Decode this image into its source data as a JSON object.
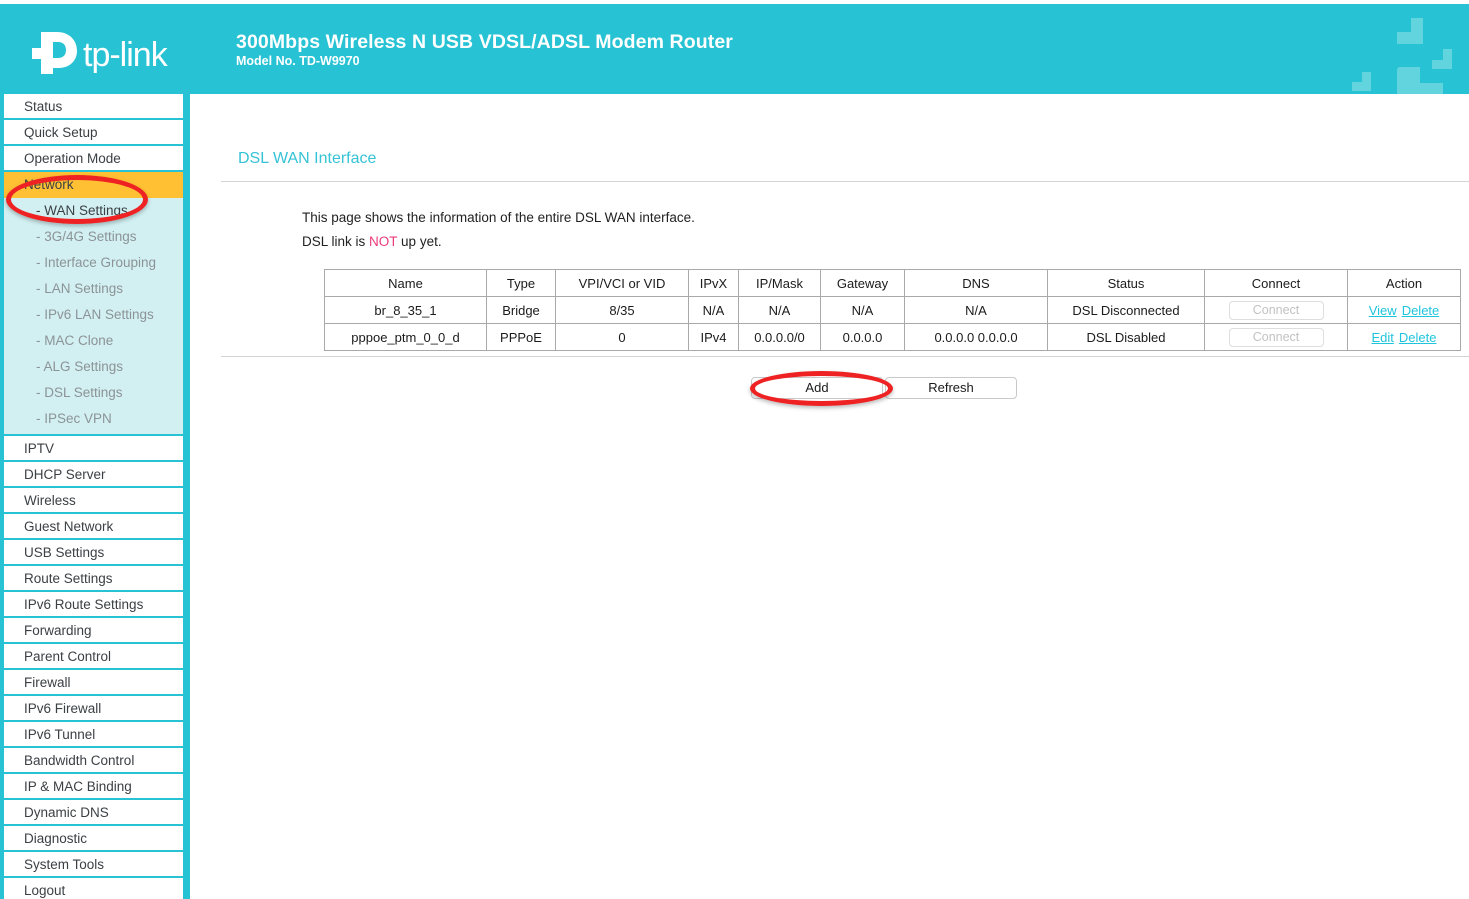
{
  "header": {
    "brand": "tp-link",
    "title": "300Mbps Wireless N USB VDSL/ADSL Modem Router",
    "model": "Model No. TD-W9970",
    "brand_color": "#27c2d3"
  },
  "sidebar": {
    "items": [
      {
        "label": "Status",
        "active": false
      },
      {
        "label": "Quick Setup",
        "active": false
      },
      {
        "label": "Operation Mode",
        "active": false
      },
      {
        "label": "Network",
        "active": true
      }
    ],
    "sub_items": [
      {
        "label": "- WAN Settings",
        "selected": true
      },
      {
        "label": "- 3G/4G Settings",
        "selected": false
      },
      {
        "label": "- Interface Grouping",
        "selected": false
      },
      {
        "label": "- LAN Settings",
        "selected": false
      },
      {
        "label": "- IPv6 LAN Settings",
        "selected": false
      },
      {
        "label": "- MAC Clone",
        "selected": false
      },
      {
        "label": "- ALG Settings",
        "selected": false
      },
      {
        "label": "- DSL Settings",
        "selected": false
      },
      {
        "label": "- IPSec VPN",
        "selected": false
      }
    ],
    "items_after": [
      {
        "label": "IPTV"
      },
      {
        "label": "DHCP Server"
      },
      {
        "label": "Wireless"
      },
      {
        "label": "Guest Network"
      },
      {
        "label": "USB Settings"
      },
      {
        "label": "Route Settings"
      },
      {
        "label": "IPv6 Route Settings"
      },
      {
        "label": "Forwarding"
      },
      {
        "label": "Parent Control"
      },
      {
        "label": "Firewall"
      },
      {
        "label": "IPv6 Firewall"
      },
      {
        "label": "IPv6 Tunnel"
      },
      {
        "label": "Bandwidth Control"
      },
      {
        "label": "IP & MAC Binding"
      },
      {
        "label": "Dynamic DNS"
      },
      {
        "label": "Diagnostic"
      },
      {
        "label": "System Tools"
      },
      {
        "label": "Logout"
      }
    ],
    "active_color": "#ffc033",
    "submenu_color": "#d2f0f2"
  },
  "main": {
    "page_title": "DSL WAN Interface",
    "intro_line1": "This page shows the information of the entire DSL WAN interface.",
    "intro_line2_pre": "DSL link is ",
    "intro_line2_emph": "NOT",
    "intro_line2_post": " up yet.",
    "emph_color": "#ea3b7b",
    "table": {
      "columns": [
        "Name",
        "Type",
        "VPI/VCI or VID",
        "IPvX",
        "IP/Mask",
        "Gateway",
        "DNS",
        "Status",
        "Connect",
        "Action"
      ],
      "rows": [
        {
          "name": "br_8_35_1",
          "type": "Bridge",
          "vpi_vci": "8/35",
          "ipvx": "N/A",
          "ip_mask": "N/A",
          "gateway": "N/A",
          "dns": "N/A",
          "status": "DSL Disconnected",
          "connect_label": "Connect",
          "connect_disabled": true,
          "actions": [
            "View",
            "Delete"
          ]
        },
        {
          "name": "pppoe_ptm_0_0_d",
          "type": "PPPoE",
          "vpi_vci": "0",
          "ipvx": "IPv4",
          "ip_mask": "0.0.0.0/0",
          "gateway": "0.0.0.0",
          "dns": "0.0.0.0 0.0.0.0",
          "status": "DSL Disabled",
          "connect_label": "Connect",
          "connect_disabled": true,
          "actions": [
            "Edit",
            "Delete"
          ]
        }
      ],
      "link_color": "#1fc4dd"
    },
    "buttons": {
      "add": "Add",
      "refresh": "Refresh"
    }
  },
  "annotations": {
    "color": "#ee2222",
    "shapes": [
      {
        "name": "network-wan-settings-highlight"
      },
      {
        "name": "add-button-highlight"
      }
    ]
  }
}
